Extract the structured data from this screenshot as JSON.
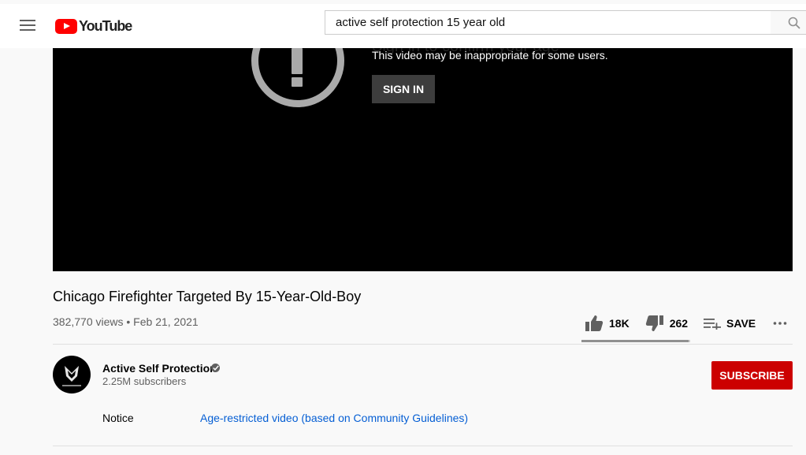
{
  "header": {
    "logo_text": "YouTube",
    "search_value": "active self protection 15 year old"
  },
  "player": {
    "warning_heading": "Sign in to confirm your age",
    "warning_message": "This video may be inappropriate for some users.",
    "signin_label": "SIGN IN"
  },
  "video": {
    "title": "Chicago Firefighter Targeted By 15-Year-Old-Boy",
    "meta": "382,770 views • Feb 21, 2021",
    "likes": "18K",
    "dislikes": "262",
    "save_label": "SAVE",
    "like_ratio": 0.986
  },
  "channel": {
    "name": "Active Self Protection",
    "subscribers": "2.25M subscribers",
    "subscribe_label": "SUBSCRIBE"
  },
  "notice": {
    "label": "Notice",
    "link_text": "Age-restricted video (based on Community Guidelines)"
  },
  "colors": {
    "brand_red": "#ff0000",
    "subscribe_red": "#cc0000",
    "link_blue": "#065fd4"
  }
}
